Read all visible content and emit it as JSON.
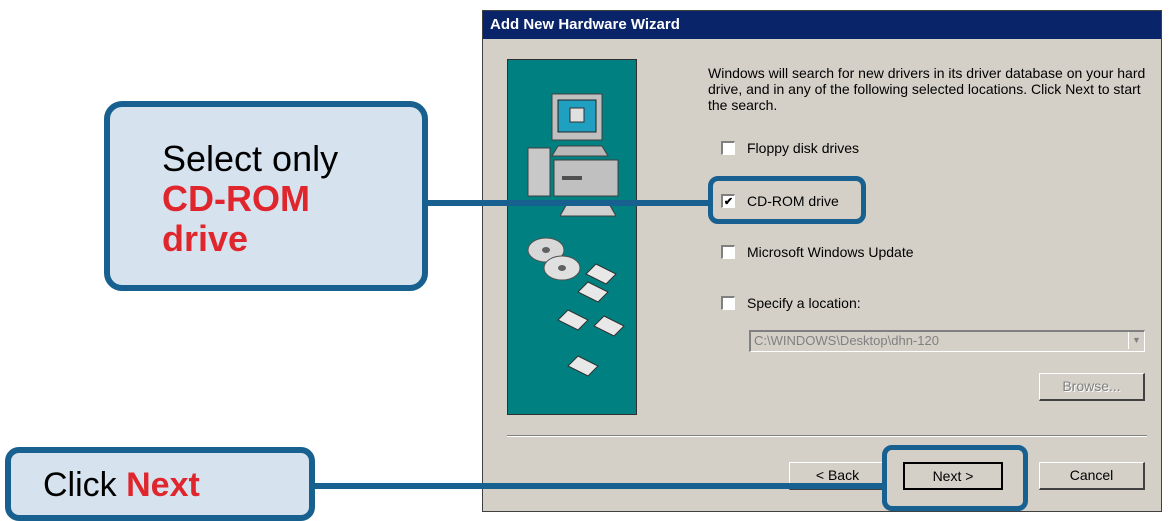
{
  "dialog": {
    "title": "Add New Hardware Wizard",
    "intro_text": "Windows will search for new drivers in its driver database on your hard drive, and in any of the following selected locations. Click Next to start the search.",
    "options": [
      {
        "label": "Floppy disk drives",
        "checked": false
      },
      {
        "label": "CD-ROM drive",
        "checked": true
      },
      {
        "label": "Microsoft Windows Update",
        "checked": false
      },
      {
        "label": "Specify a location:",
        "checked": false
      }
    ],
    "location_value": "C:\\WINDOWS\\Desktop\\dhn-120",
    "check_mark": "✔",
    "combo_arrow": "▼",
    "browse_label": "Browse...",
    "back_label": "< Back",
    "next_label": "Next >",
    "cancel_label": "Cancel"
  },
  "callouts": {
    "select_prefix": "Select only",
    "select_highlight": "CD-ROM drive",
    "click_prefix": "Click",
    "click_highlight": "Next"
  },
  "colors": {
    "callout_border": "#17608f",
    "callout_fill": "#d6e3ef",
    "highlight_text": "#e0262d",
    "titlebar": "#0a246a",
    "panel": "#008080"
  }
}
